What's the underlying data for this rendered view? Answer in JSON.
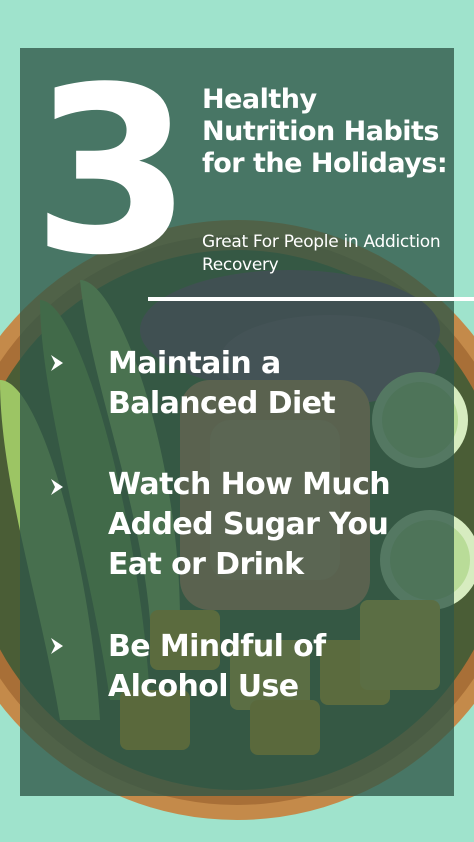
{
  "number": "3",
  "title": "Healthy Nutrition Habits for the Holidays:",
  "subtitle": "Great For People in Addiction Recovery",
  "habits": [
    {
      "text": "Maintain a Balanced Diet",
      "icon": "chevron-right-icon"
    },
    {
      "text": "Watch How Much Added Sugar You Eat or Drink",
      "icon": "chevron-right-icon"
    },
    {
      "text": "Be Mindful of Alcohol Use",
      "icon": "chevron-right-icon"
    }
  ],
  "colors": {
    "background": "#9fe3cc",
    "panel": "#2f5748",
    "text": "#ffffff",
    "bowl": "#c48a4a",
    "avocado": "#7fae4e",
    "salmon": "#f08a6a",
    "mango": "#f4b21c",
    "cabbage": "#7a3a78"
  }
}
